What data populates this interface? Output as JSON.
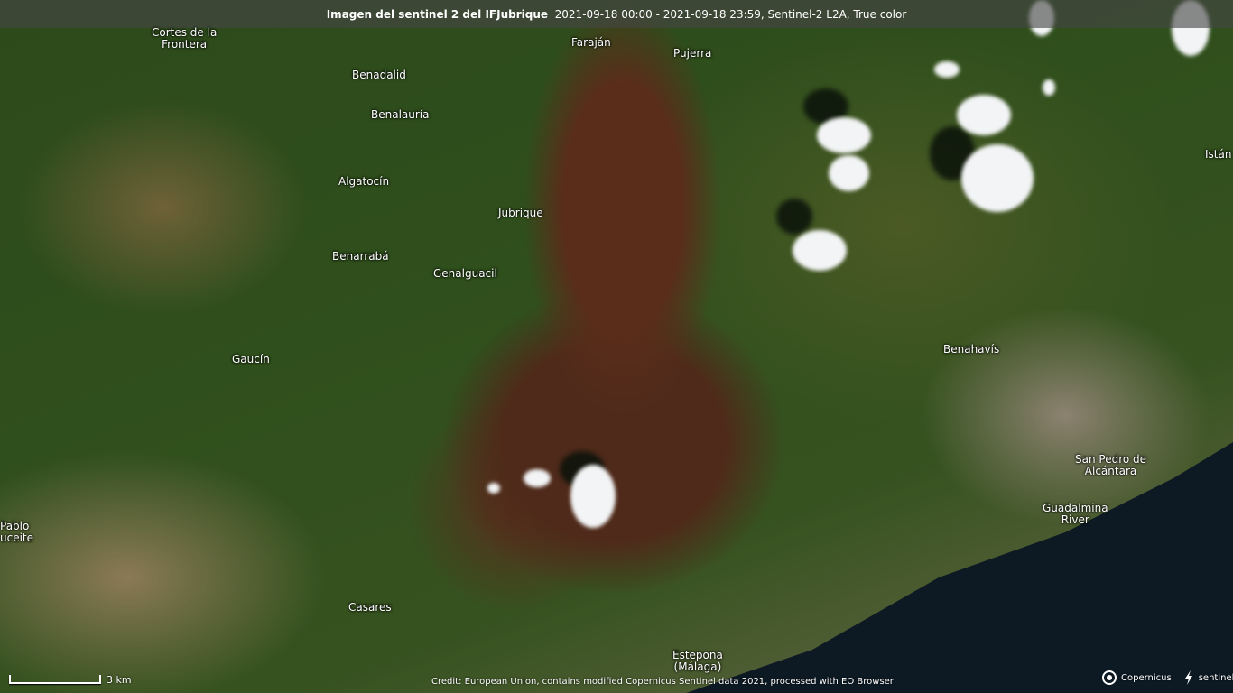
{
  "header": {
    "title": "Imagen del sentinel 2 del IFJubrique",
    "subtitle": "2021-09-18 00:00 - 2021-09-18 23:59, Sentinel-2 L2A, True color"
  },
  "places": [
    {
      "id": "cortes",
      "name": "Cortes de la\nFrontera"
    },
    {
      "id": "farajan",
      "name": "Faraján"
    },
    {
      "id": "pujerra",
      "name": "Pujerra"
    },
    {
      "id": "benadalid",
      "name": "Benadalid"
    },
    {
      "id": "benalauria",
      "name": "Benalauría"
    },
    {
      "id": "algatocin",
      "name": "Algatocín"
    },
    {
      "id": "jubrique",
      "name": "Jubrique"
    },
    {
      "id": "benarraba",
      "name": "Benarrabá"
    },
    {
      "id": "genalguacil",
      "name": "Genalguacil"
    },
    {
      "id": "istan",
      "name": "Istán"
    },
    {
      "id": "gaucin",
      "name": "Gaucín"
    },
    {
      "id": "benahavis",
      "name": "Benahavís"
    },
    {
      "id": "sanpedro",
      "name": "San Pedro de\nAlcántara"
    },
    {
      "id": "guadalmina",
      "name": "Guadalmina\nRiver"
    },
    {
      "id": "pablo",
      "name": "Pablo\nuceite"
    },
    {
      "id": "casares",
      "name": "Casares"
    },
    {
      "id": "estepona",
      "name": "Estepona\n(Málaga)"
    }
  ],
  "footer": {
    "credit": "Credit: European Union, contains modified Copernicus Sentinel data 2021, processed with EO Browser",
    "scale_label": "3 km",
    "logo_copernicus": "Copernicus",
    "logo_sentinelhub": "sentinelhub"
  }
}
